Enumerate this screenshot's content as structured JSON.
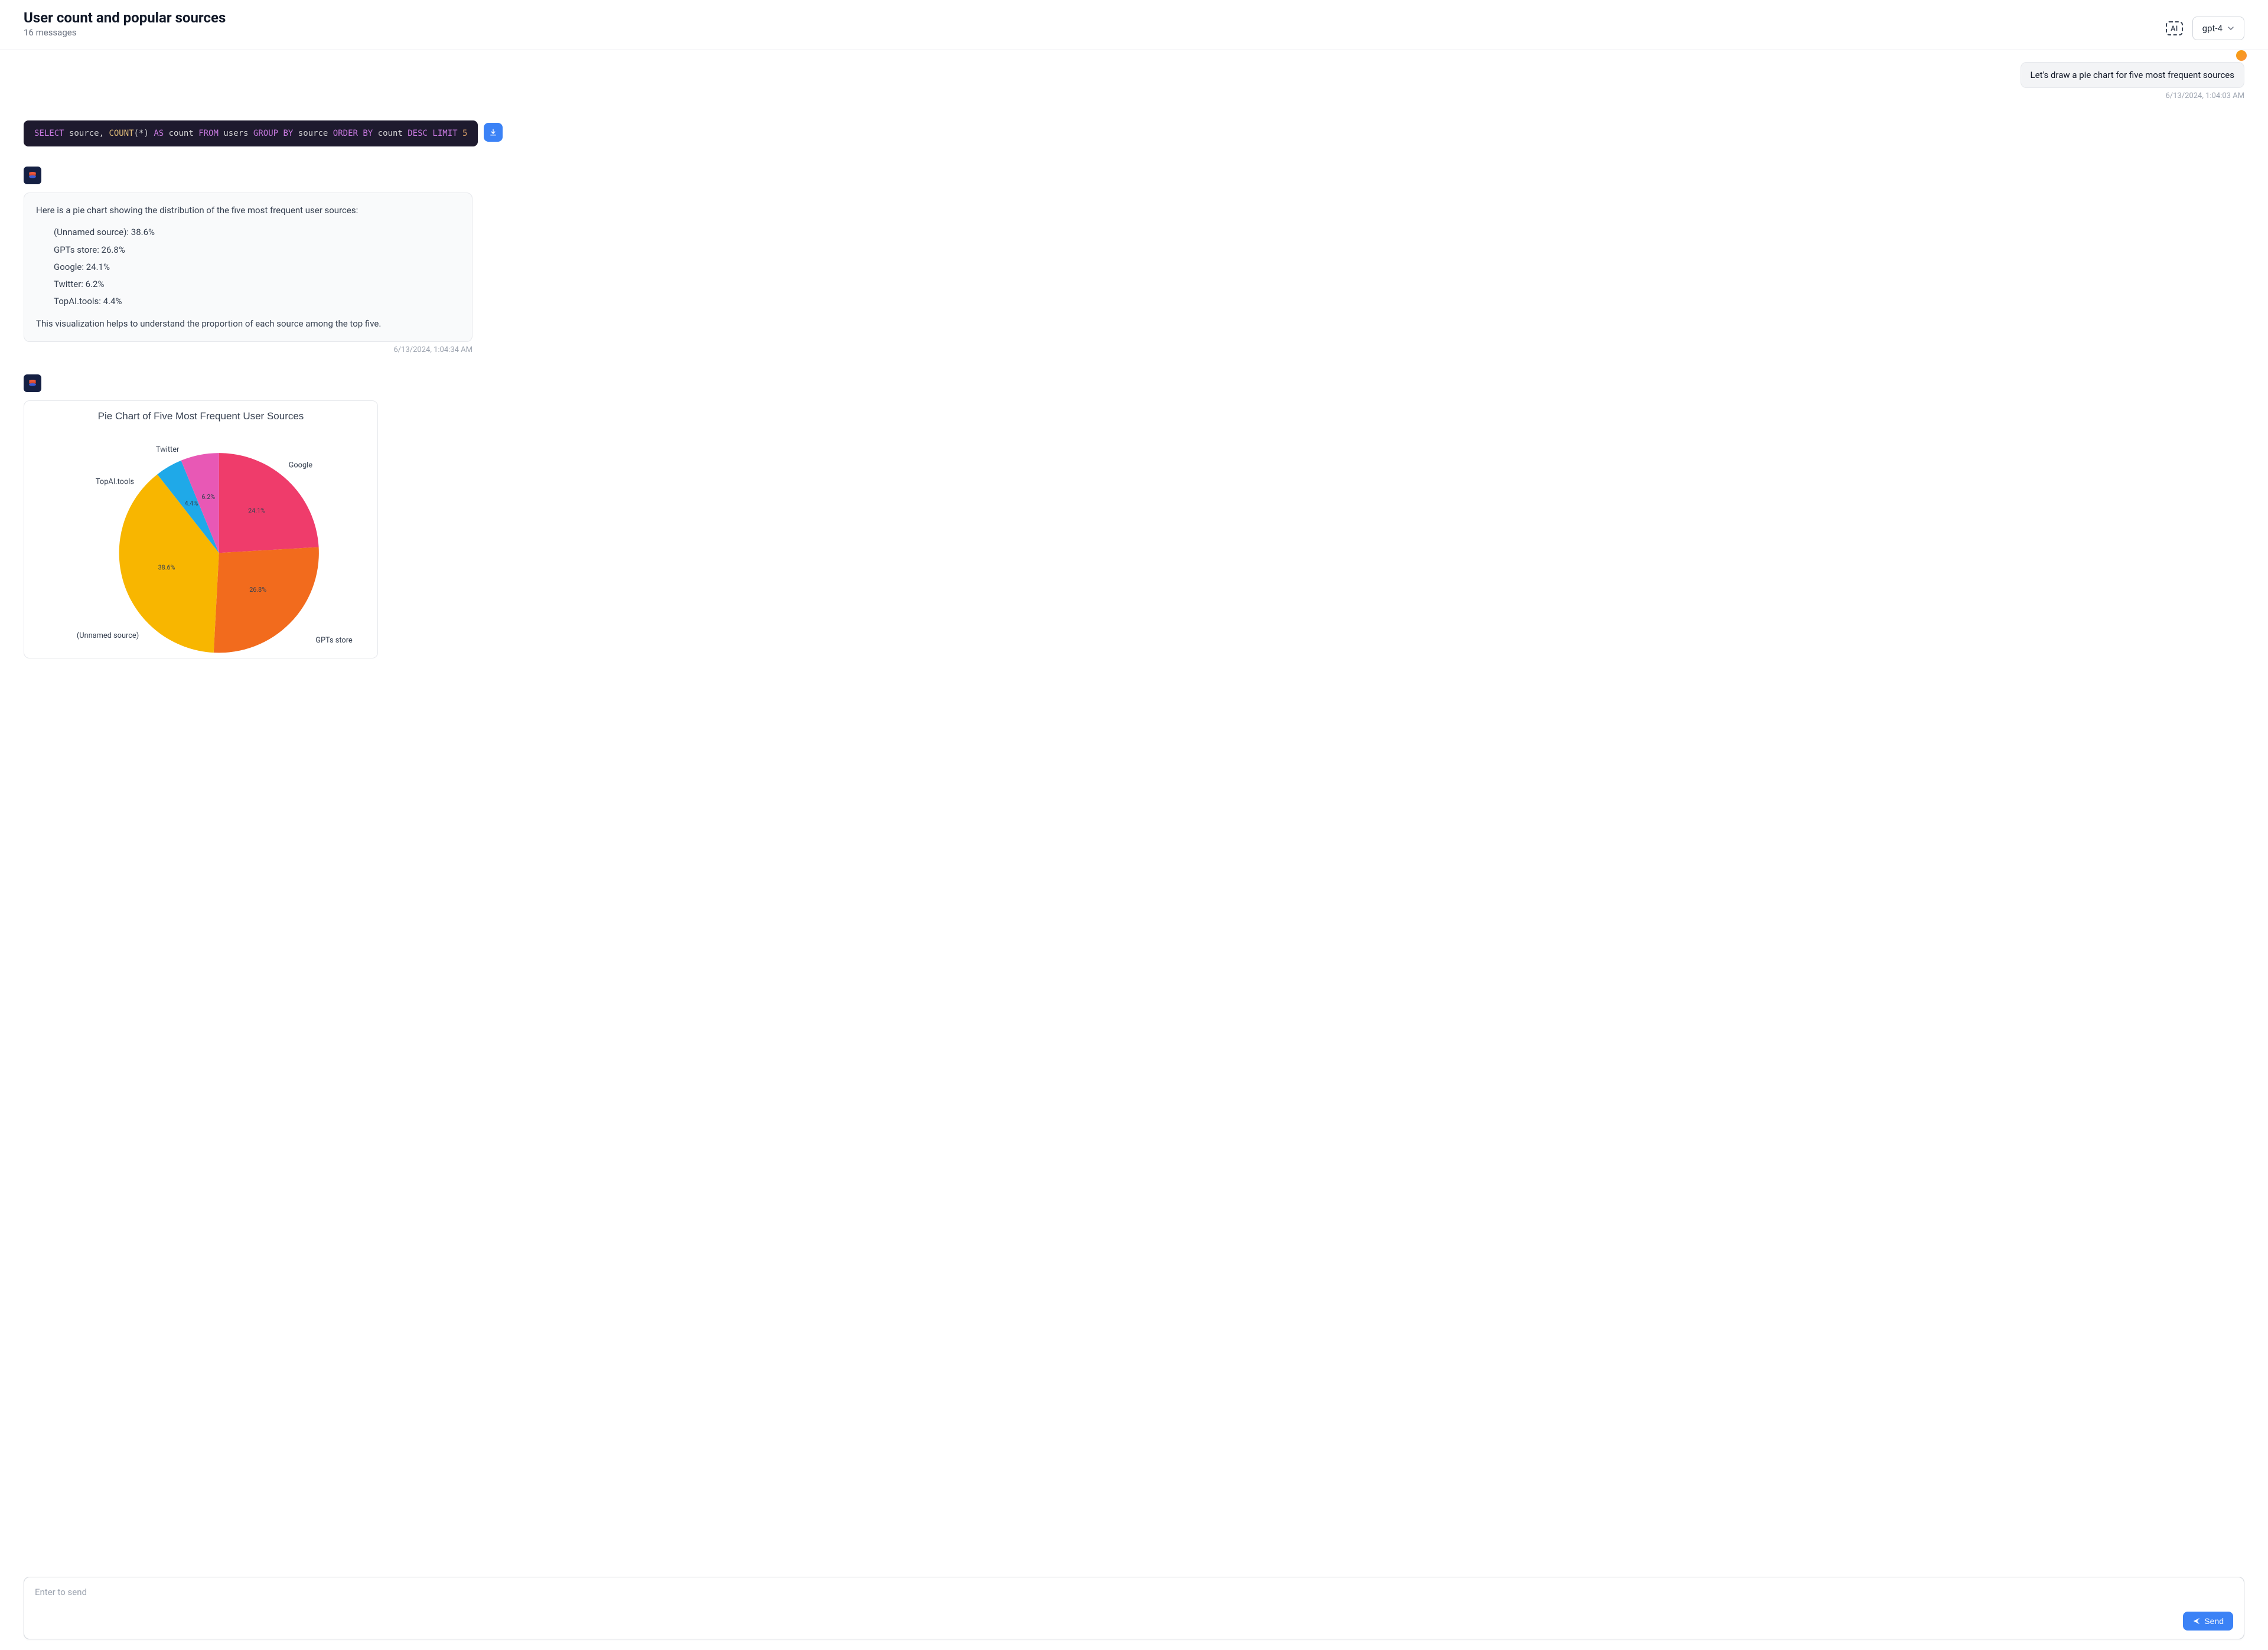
{
  "header": {
    "title": "User count and popular sources",
    "subtitle": "16 messages",
    "ai_badge": "AI",
    "model": "gpt-4"
  },
  "messages": {
    "user1": {
      "text": "Let's draw a pie chart for five most frequent sources",
      "time": "6/13/2024, 1:04:03 AM"
    },
    "sql": {
      "tokens": {
        "select": "SELECT",
        "source": " source, ",
        "count_fn": "COUNT",
        "paren": "(*) ",
        "as": "AS",
        "count_alias": " count ",
        "from": "FROM",
        "users": " users ",
        "group_by": "GROUP BY",
        "source2": " source ",
        "order_by": "ORDER BY",
        "count2": " count ",
        "desc": "DESC",
        "space": " ",
        "limit": "LIMIT",
        "space2": " ",
        "five": "5"
      }
    },
    "ai1": {
      "intro": "Here is a pie chart showing the distribution of the five most frequent user sources:",
      "items": [
        "(Unnamed source): 38.6%",
        "GPTs store: 26.8%",
        "Google: 24.1%",
        "Twitter: 6.2%",
        "TopAI.tools: 4.4%"
      ],
      "outro": "This visualization helps to understand the proportion of each source among the top five.",
      "time": "6/13/2024, 1:04:34 AM"
    }
  },
  "chart_data": {
    "type": "pie",
    "title": "Pie Chart of Five Most Frequent User Sources",
    "categories": [
      "Google",
      "GPTs store",
      "(Unnamed source)",
      "TopAI.tools",
      "Twitter"
    ],
    "values": [
      24.1,
      26.8,
      38.6,
      4.4,
      6.2
    ],
    "colors": [
      "#ef3c6b",
      "#f26b1d",
      "#f8b600",
      "#1fa9e8",
      "#e858b5"
    ],
    "pct_labels": [
      "24.1%",
      "26.8%",
      "38.6%",
      "4.4%",
      "6.2%"
    ]
  },
  "composer": {
    "placeholder": "Enter to send",
    "send_label": "Send"
  }
}
